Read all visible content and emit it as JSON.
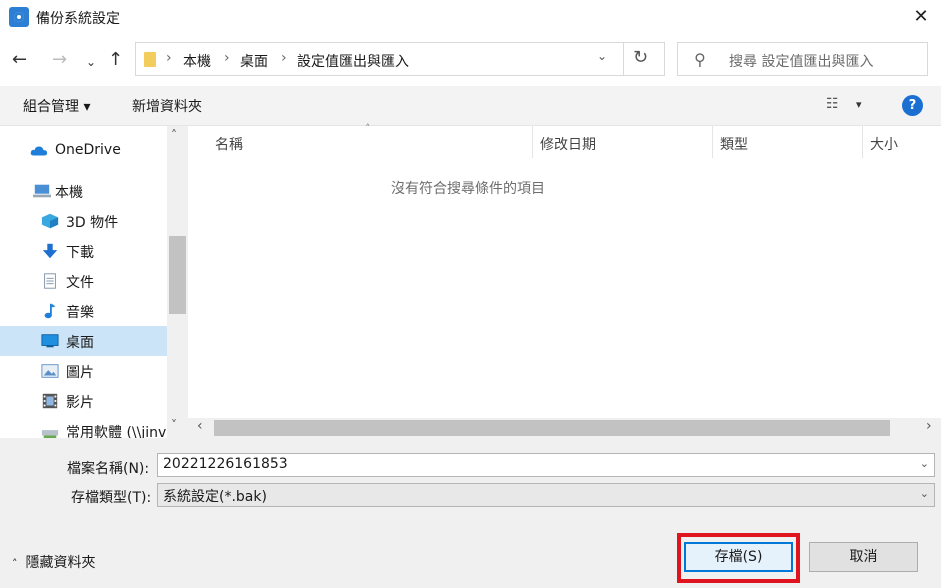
{
  "window": {
    "title": "備份系統設定",
    "close_glyph": "✕"
  },
  "nav": {
    "back": "←",
    "forward": "→",
    "recent": "⌄",
    "up": "↑",
    "breadcrumb": [
      "本機",
      "桌面",
      "設定值匯出與匯入"
    ],
    "separator": "›",
    "dropdown": "⌄",
    "refresh": "↻",
    "search_placeholder": "搜尋 設定值匯出與匯入"
  },
  "toolbar": {
    "organize": "組合管理 ▾",
    "new_folder": "新增資料夾",
    "view_icon": "☷",
    "view_dd": "▾",
    "help": "?"
  },
  "sidebar": {
    "items": [
      {
        "label": "OneDrive",
        "icon": "cloud-icon",
        "color": "#1f7fd8"
      },
      {
        "label": "本機",
        "icon": "computer-icon",
        "color": "#4a8fd6"
      },
      {
        "label": "3D 物件",
        "icon": "cube-icon",
        "color": "#39a8e0"
      },
      {
        "label": "下載",
        "icon": "download-icon",
        "color": "#1f6fd0"
      },
      {
        "label": "文件",
        "icon": "document-icon",
        "color": "#7a8ea6"
      },
      {
        "label": "音樂",
        "icon": "music-icon",
        "color": "#1f7fd8"
      },
      {
        "label": "桌面",
        "icon": "desktop-icon",
        "color": "#1f8fe0",
        "selected": true
      },
      {
        "label": "圖片",
        "icon": "picture-icon",
        "color": "#5b8fc7"
      },
      {
        "label": "影片",
        "icon": "film-icon",
        "color": "#555555"
      },
      {
        "label": "常用軟體 (\\\\jinv",
        "icon": "network-drive-icon",
        "color": "#6aa84f"
      }
    ],
    "scroll_up": "˄",
    "scroll_down": "˅"
  },
  "files": {
    "columns": [
      "名稱",
      "修改日期",
      "類型",
      "大小"
    ],
    "sort_caret": "˄",
    "empty_message": "沒有符合搜尋條件的項目",
    "scroll_left": "‹",
    "scroll_right": "›"
  },
  "form": {
    "filename_label": "檔案名稱(N):",
    "filename_value": "20221226161853",
    "type_label": "存檔類型(T):",
    "type_value": "系統設定(*.bak)",
    "dd": "⌄",
    "hide_folders_caret": "˄",
    "hide_folders": "隱藏資料夾",
    "save": "存檔(S)",
    "cancel": "取消"
  },
  "colors": {
    "highlight": "#e0141f",
    "accent": "#0078d7",
    "selected_row": "#cce4f7"
  }
}
